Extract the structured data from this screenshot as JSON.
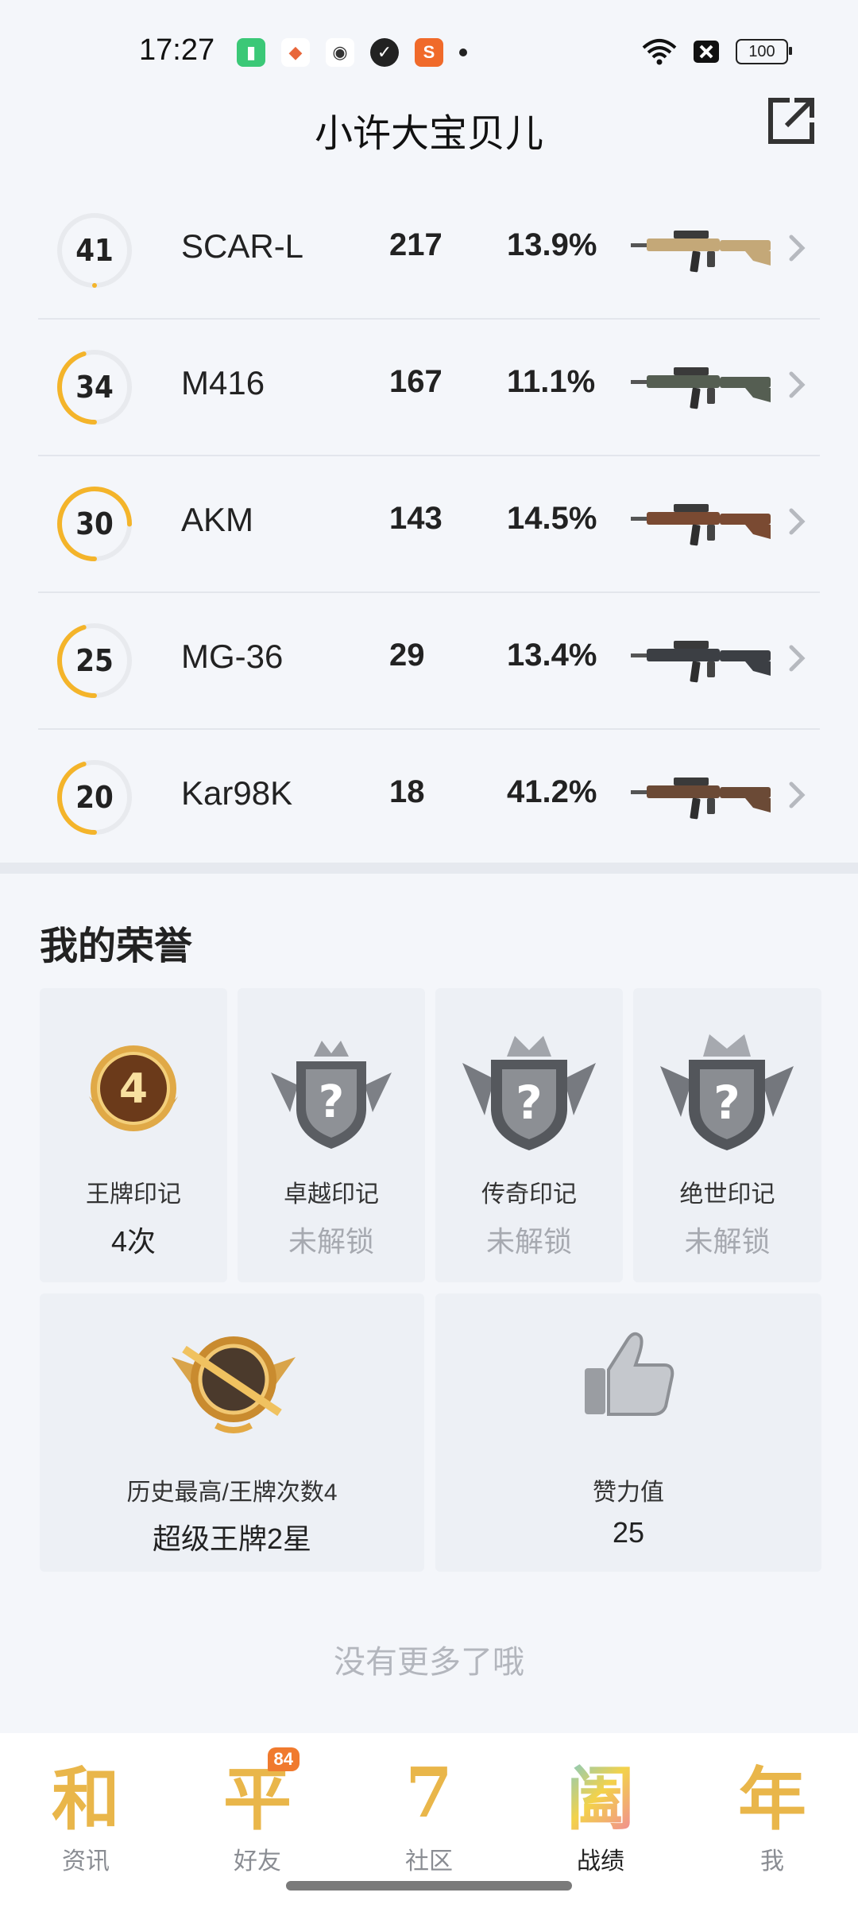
{
  "status_bar": {
    "time": "17:27",
    "left_icons": [
      "battery-saver-icon",
      "game-icon",
      "android-icon",
      "shield-icon",
      "sogou-icon"
    ],
    "battery": "100"
  },
  "header": {
    "title": "小许大宝贝儿",
    "share_icon": "share-icon"
  },
  "weapons": [
    {
      "rank": "41",
      "ring_fill": 0.0,
      "name": "SCAR-L",
      "kills": "217",
      "rate": "13.9%",
      "color": "#c4a878"
    },
    {
      "rank": "34",
      "ring_fill": 0.45,
      "name": "M416",
      "kills": "167",
      "rate": "11.1%",
      "color": "#555e52"
    },
    {
      "rank": "30",
      "ring_fill": 0.75,
      "name": "AKM",
      "kills": "143",
      "rate": "14.5%",
      "color": "#7a4a32"
    },
    {
      "rank": "25",
      "ring_fill": 0.45,
      "name": "MG-36",
      "kills": "29",
      "rate": "13.4%",
      "color": "#3c3f44"
    },
    {
      "rank": "20",
      "ring_fill": 0.45,
      "name": "Kar98K",
      "kills": "18",
      "rate": "41.2%",
      "color": "#6b4a36"
    }
  ],
  "honor": {
    "title": "我的荣誉",
    "marks": [
      {
        "label": "王牌印记",
        "value": "4次",
        "locked": false,
        "badge_number": "4"
      },
      {
        "label": "卓越印记",
        "value": "未解锁",
        "locked": true
      },
      {
        "label": "传奇印记",
        "value": "未解锁",
        "locked": true
      },
      {
        "label": "绝世印记",
        "value": "未解锁",
        "locked": true
      }
    ],
    "highest": {
      "label": "历史最高/王牌次数4",
      "value": "超级王牌2星"
    },
    "likes": {
      "label": "赞力值",
      "value": "25"
    }
  },
  "footer_text": "没有更多了哦",
  "nav": [
    {
      "glyph": "和",
      "label": "资讯",
      "active": false
    },
    {
      "glyph": "平",
      "label": "好友",
      "badge": "84",
      "active": false
    },
    {
      "glyph": "7",
      "label": "社区",
      "active": false
    },
    {
      "glyph": "阖",
      "label": "战绩",
      "active": true
    },
    {
      "glyph": "年",
      "label": "我",
      "active": false
    }
  ],
  "colors": {
    "accent": "#f4b42a",
    "ring_track": "#e8eaee",
    "locked_text": "#a6a9b0"
  }
}
